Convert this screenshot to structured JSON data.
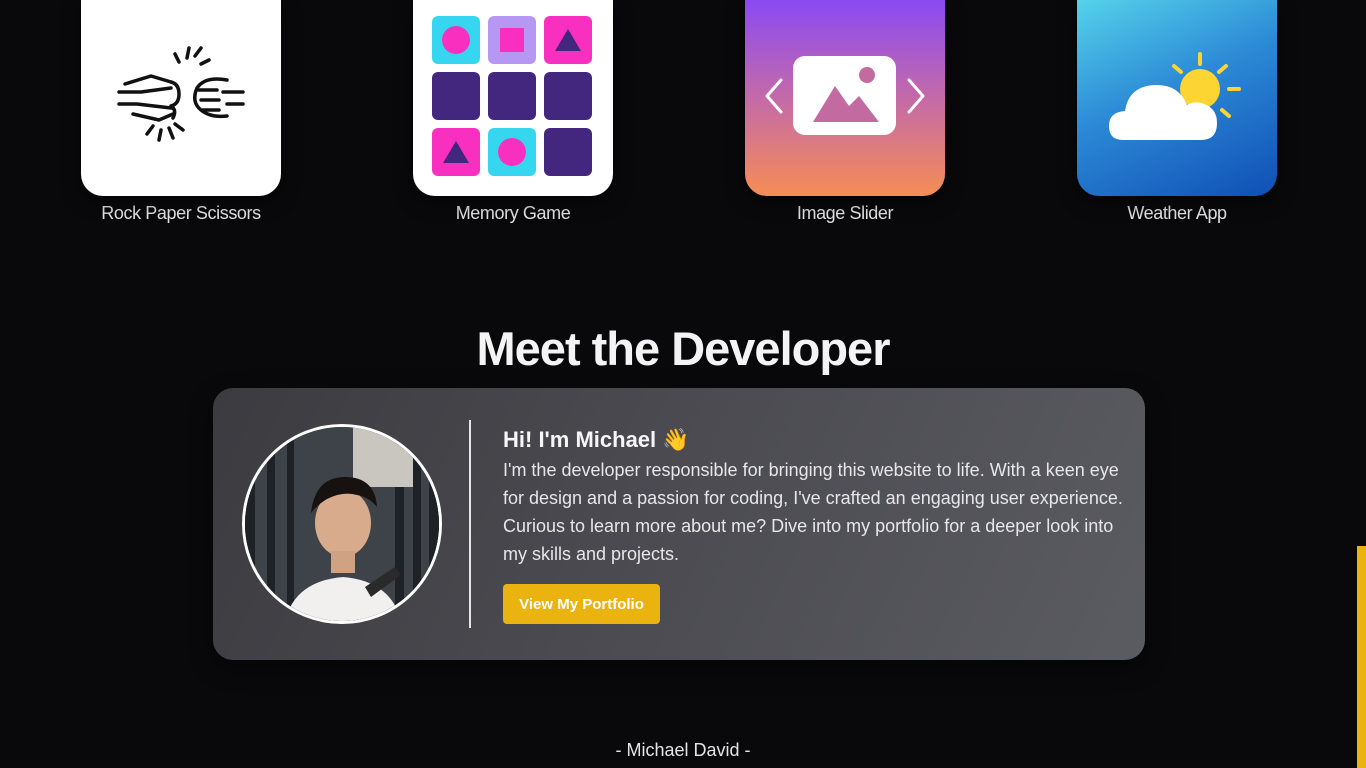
{
  "apps": [
    {
      "label": "Rock Paper Scissors",
      "icon": "fist-bump-icon"
    },
    {
      "label": "Memory Game",
      "icon": "memory-grid-icon"
    },
    {
      "label": "Image Slider",
      "icon": "image-slider-icon"
    },
    {
      "label": "Weather App",
      "icon": "weather-sun-cloud-icon"
    }
  ],
  "developer": {
    "section_title": "Meet the Developer",
    "greeting": "Hi! I'm Michael",
    "greeting_emoji": "👋",
    "bio": "I'm the developer responsible for bringing this website to life. With a keen eye for design and a passion for coding, I've crafted an engaging user experience. Curious to learn more about me? Dive into my portfolio for a deeper look into my skills and projects.",
    "button_label": "View My Portfolio"
  },
  "footer": {
    "signature": "- Michael David -"
  },
  "colors": {
    "background": "#09090b",
    "accent": "#eab30f",
    "card": "#4a4a50"
  }
}
